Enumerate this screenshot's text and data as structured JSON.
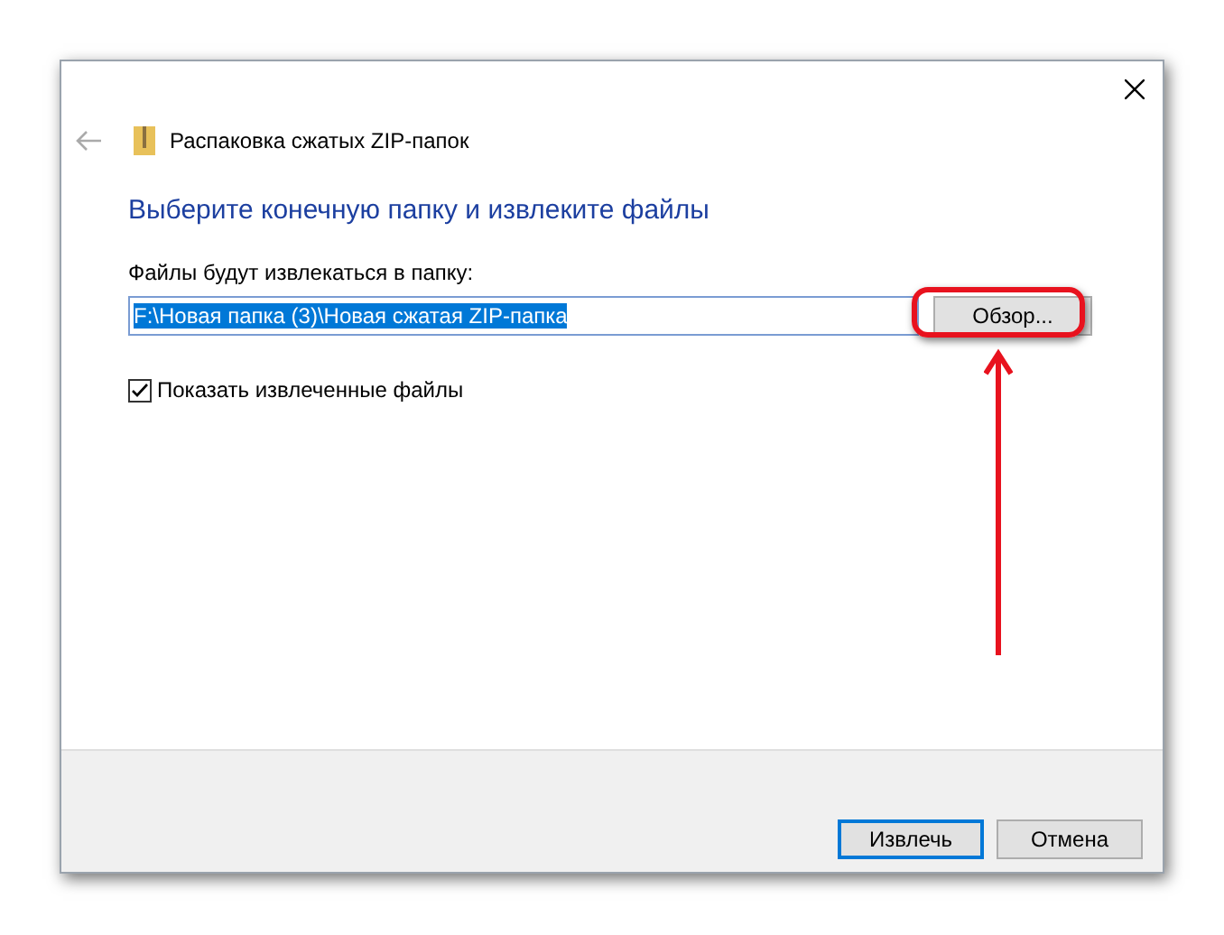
{
  "window": {
    "title": "Распаковка сжатых ZIP-папок"
  },
  "heading": "Выберите конечную папку и извлеките файлы",
  "destination": {
    "label": "Файлы будут извлекаться в папку:",
    "value": "F:\\Новая папка (3)\\Новая сжатая ZIP-папка",
    "selected": true,
    "browse_button": "Обзор...",
    "highlighted": true
  },
  "show_files": {
    "label": "Показать извлеченные файлы",
    "checked": true
  },
  "buttons": [
    {
      "label": "Извлечь",
      "default": true
    },
    {
      "label": "Отмена",
      "default": false
    }
  ]
}
